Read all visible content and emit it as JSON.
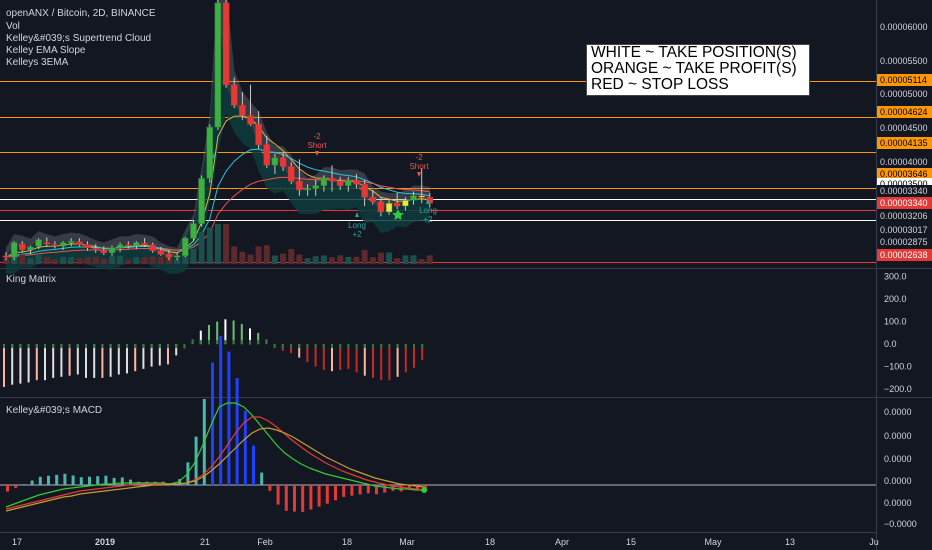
{
  "header": {
    "title": "openANX / Bitcoin, 2D, BINANCE",
    "studies": [
      "Vol",
      "Kelley&#039;s Supertrend Cloud",
      "Kelley EMA Slope",
      "Kelleys 3EMA"
    ]
  },
  "annotation": {
    "lines": [
      "WHITE ~ TAKE POSITION(S)",
      "ORANGE ~ TAKE PROFIT(S)",
      "RED ~ STOP LOSS"
    ]
  },
  "price_axis": {
    "ticks": [
      "0.00006000",
      "0.00005500",
      "0.00005000",
      "0.00004500",
      "0.00004000",
      "0.00003500",
      "0.00003017",
      "0.00002875"
    ],
    "badges": [
      {
        "text": "0.00005114",
        "kind": "orange"
      },
      {
        "text": "0.00004624",
        "kind": "orange"
      },
      {
        "text": "0.00004135",
        "kind": "orange"
      },
      {
        "text": "0.00003646",
        "kind": "orange"
      },
      {
        "text": "0.00003500",
        "kind": "white"
      },
      {
        "text": "0.00003340",
        "kind": "plain"
      },
      {
        "text": "0.00003340",
        "kind": "red"
      },
      {
        "text": "0.00003206",
        "kind": "plain"
      },
      {
        "text": "0.00002638",
        "kind": "red"
      }
    ]
  },
  "chart_markers": {
    "short1": [
      "-2",
      "Short"
    ],
    "short2": [
      "-2",
      "Short"
    ],
    "long1": [
      "Long",
      "+2"
    ],
    "long2": [
      "Long",
      "+2"
    ]
  },
  "king_matrix": {
    "title": "King Matrix",
    "ticks": [
      "300.0",
      "200.0",
      "100.0",
      "0.0",
      "−100.0",
      "−200.0"
    ]
  },
  "macd": {
    "title": "Kelley&#039;s MACD",
    "ticks": [
      "0.0000",
      "0.0000",
      "0.0000",
      "0.0000",
      "0.0000",
      "−0.0000",
      "−0.0000"
    ]
  },
  "time_axis": {
    "labels": [
      "17",
      "2019",
      "21",
      "Feb",
      "18",
      "Mar",
      "18",
      "Apr",
      "15",
      "May",
      "13",
      "Ju"
    ]
  },
  "colors": {
    "background": "#131722",
    "up": "#26a69a",
    "down": "#ef5350",
    "orange_level": "#ff9800",
    "red_level": "#e53935",
    "white_level": "#ffffff",
    "green_bar": "#7cb342",
    "blue_bar": "#1e40ff",
    "macd_green": "#33cc33",
    "macd_red": "#e53935",
    "macd_orange": "#c69c35"
  },
  "chart_data": [
    {
      "type": "candlestick",
      "title": "openANX / Bitcoin, 2D, BINANCE",
      "unit": "BTC",
      "ylim": [
        2.58e-05,
        6.22e-05
      ],
      "x_labels": [
        "17",
        "2019",
        "21",
        "Feb",
        "18",
        "Mar",
        "18",
        "Apr",
        "15",
        "May",
        "13",
        "Ju"
      ],
      "candles": [
        [
          2.72e-05,
          2.77e-05,
          2.66e-05,
          2.7e-05
        ],
        [
          2.7e-05,
          2.92e-05,
          2.66e-05,
          2.9e-05
        ],
        [
          2.88e-05,
          2.92e-05,
          2.76e-05,
          2.8e-05
        ],
        [
          2.8e-05,
          2.86e-05,
          2.74e-05,
          2.84e-05
        ],
        [
          2.85e-05,
          2.96e-05,
          2.81e-05,
          2.94e-05
        ],
        [
          2.9e-05,
          2.97e-05,
          2.84e-05,
          2.88e-05
        ],
        [
          2.87e-05,
          2.92e-05,
          2.82e-05,
          2.86e-05
        ],
        [
          2.85e-05,
          2.92e-05,
          2.8e-05,
          2.9e-05
        ],
        [
          2.9e-05,
          2.96e-05,
          2.85e-05,
          2.92e-05
        ],
        [
          2.91e-05,
          2.96e-05,
          2.85e-05,
          2.87e-05
        ],
        [
          2.87e-05,
          2.92e-05,
          2.79e-05,
          2.83e-05
        ],
        [
          2.82e-05,
          2.88e-05,
          2.76e-05,
          2.8e-05
        ],
        [
          2.79e-05,
          2.85e-05,
          2.73e-05,
          2.76e-05
        ],
        [
          2.76e-05,
          2.86e-05,
          2.72e-05,
          2.83e-05
        ],
        [
          2.82e-05,
          2.9e-05,
          2.77e-05,
          2.87e-05
        ],
        [
          2.87e-05,
          2.92e-05,
          2.82e-05,
          2.86e-05
        ],
        [
          2.86e-05,
          2.92e-05,
          2.81e-05,
          2.9e-05
        ],
        [
          2.89e-05,
          2.96e-05,
          2.84e-05,
          2.87e-05
        ],
        [
          2.87e-05,
          2.9e-05,
          2.76e-05,
          2.79e-05
        ],
        [
          2.79e-05,
          2.84e-05,
          2.72e-05,
          2.74e-05
        ],
        [
          2.74e-05,
          2.8e-05,
          2.66e-05,
          2.7e-05
        ],
        [
          2.7e-05,
          2.76e-05,
          2.66e-05,
          2.72e-05
        ],
        [
          2.72e-05,
          2.98e-05,
          2.7e-05,
          2.96e-05
        ],
        [
          2.96e-05,
          3.2e-05,
          2.92e-05,
          3.16e-05
        ],
        [
          3.16e-05,
          3.82e-05,
          3.12e-05,
          3.78e-05
        ],
        [
          3.78e-05,
          4.52e-05,
          3.72e-05,
          4.48e-05
        ],
        [
          4.48e-05,
          6.22e-05,
          4.44e-05,
          6.18e-05
        ],
        [
          6.18e-05,
          6.22e-05,
          5.02e-05,
          5.06e-05
        ],
        [
          5.06e-05,
          5.16e-05,
          4.74e-05,
          4.78e-05
        ],
        [
          4.78e-05,
          4.96e-05,
          4.58e-05,
          4.64e-05
        ],
        [
          4.64e-05,
          5.06e-05,
          4.5e-05,
          4.52e-05
        ],
        [
          4.52e-05,
          4.7e-05,
          4.18e-05,
          4.24e-05
        ],
        [
          4.24e-05,
          4.36e-05,
          3.92e-05,
          3.96e-05
        ],
        [
          3.96e-05,
          4.12e-05,
          3.84e-05,
          4.06e-05
        ],
        [
          4.06e-05,
          4.14e-05,
          3.88e-05,
          3.94e-05
        ],
        [
          3.94e-05,
          4e-05,
          3.7e-05,
          3.74e-05
        ],
        [
          3.74e-05,
          4.04e-05,
          3.54e-05,
          3.62e-05
        ],
        [
          3.62e-05,
          3.7e-05,
          3.54e-05,
          3.64e-05
        ],
        [
          3.64e-05,
          3.76e-05,
          3.54e-05,
          3.68e-05
        ],
        [
          3.68e-05,
          3.82e-05,
          3.6e-05,
          3.78e-05
        ],
        [
          3.78e-05,
          3.96e-05,
          3.6e-05,
          3.74e-05
        ],
        [
          3.74e-05,
          3.8e-05,
          3.62e-05,
          3.68e-05
        ],
        [
          3.68e-05,
          3.8e-05,
          3.6e-05,
          3.75e-05
        ],
        [
          3.75e-05,
          3.84e-05,
          3.64e-05,
          3.7e-05
        ],
        [
          3.7e-05,
          3.76e-05,
          3.4e-05,
          3.52e-05
        ],
        [
          3.52e-05,
          3.62e-05,
          3.42e-05,
          3.46e-05
        ],
        [
          3.46e-05,
          3.52e-05,
          3.26e-05,
          3.32e-05
        ],
        [
          3.32e-05,
          3.5e-05,
          3.28e-05,
          3.44e-05
        ],
        [
          3.44e-05,
          3.58e-05,
          3.36e-05,
          3.4e-05
        ],
        [
          3.4e-05,
          3.52e-05,
          3.34e-05,
          3.48e-05
        ],
        [
          3.48e-05,
          3.6e-05,
          3.42e-05,
          3.54e-05
        ],
        [
          3.54e-05,
          3.92e-05,
          3.44e-05,
          3.52e-05
        ],
        [
          3.52e-05,
          3.58e-05,
          3.38e-05,
          3.44e-05
        ]
      ],
      "levels": [
        5.114e-05,
        4.624e-05,
        4.135e-05,
        3.646e-05,
        3.5e-05,
        3.34e-05,
        3.206e-05,
        2.638e-05
      ]
    },
    {
      "type": "bar",
      "name": "King Matrix",
      "ylim": [
        -230,
        320
      ],
      "values": [
        -190,
        -180,
        -175,
        -170,
        -160,
        -160,
        -150,
        -145,
        -140,
        -135,
        -150,
        -150,
        -150,
        -145,
        -135,
        -130,
        -120,
        -110,
        -100,
        -95,
        -90,
        -50,
        -20,
        20,
        60,
        85,
        100,
        110,
        105,
        90,
        70,
        50,
        20,
        -10,
        -30,
        -40,
        -60,
        -80,
        -100,
        -115,
        -120,
        -115,
        -110,
        -125,
        -140,
        -150,
        -160,
        -160,
        -145,
        -125,
        -105,
        -70
      ],
      "ticks": [
        300,
        200,
        100,
        0,
        -100,
        -200
      ]
    },
    {
      "type": "line",
      "name": "Kelley&#039;s MACD",
      "ylim": [
        -4.5e-06,
        8.5e-06
      ],
      "series": [
        {
          "values": [
            -2.2e-06,
            -1.9e-06,
            -1.6e-06,
            -1.3e-06,
            -1e-06,
            -8e-07,
            -6e-07,
            -4e-07,
            -3e-07,
            -2e-07,
            -1e-07,
            0.0,
            1e-07,
            1e-07,
            2e-07,
            2e-07,
            2e-07,
            2e-07,
            2e-07,
            2e-07,
            1e-07,
            3e-07,
            1e-06,
            2.2e-06,
            4e-06,
            6e-06,
            7.8e-06,
            8.2e-06,
            8.2e-06,
            7.8e-06,
            7e-06,
            6e-06,
            5e-06,
            4e-06,
            3.2e-06,
            2.6e-06,
            2.1e-06,
            1.7e-06,
            1.4e-06,
            1.1e-06,
            9e-07,
            7e-07,
            5e-07,
            3e-07,
            1e-07,
            -1e-07,
            -2e-07,
            -3e-07,
            -4e-07,
            -4e-07,
            -5e-07,
            -5e-07
          ]
        },
        {
          "values": [
            -2.4e-06,
            -2.2e-06,
            -2e-06,
            -1.8e-06,
            -1.6e-06,
            -1.4e-06,
            -1.2e-06,
            -1e-06,
            -8e-07,
            -6e-07,
            -5e-07,
            -4e-07,
            -3e-07,
            -2e-07,
            -1e-07,
            0.0,
            1e-07,
            1e-07,
            1e-07,
            1e-07,
            1e-07,
            1e-07,
            2e-07,
            5e-07,
            1e-06,
            1.8e-06,
            2.8e-06,
            4e-06,
            5.2e-06,
            6.2e-06,
            6.8e-06,
            6.8e-06,
            6.4e-06,
            5.8e-06,
            5.1e-06,
            4.4e-06,
            3.8e-06,
            3.2e-06,
            2.7e-06,
            2.2e-06,
            1.8e-06,
            1.4e-06,
            1.1e-06,
            8e-07,
            5e-07,
            3e-07,
            1e-07,
            -1e-07,
            -2e-07,
            -3e-07,
            -4e-07,
            -5e-07
          ]
        },
        {
          "values": [
            -2.6e-06,
            -2.4e-06,
            -2.2e-06,
            -2e-06,
            -1.8e-06,
            -1.6e-06,
            -1.4e-06,
            -1.2e-06,
            -1.1e-06,
            -9e-07,
            -8e-07,
            -7e-07,
            -6e-07,
            -5e-07,
            -4e-07,
            -3e-07,
            -2e-07,
            -1e-07,
            0.0,
            0.0,
            1e-07,
            1e-07,
            2e-07,
            4e-07,
            8e-07,
            1.4e-06,
            2.1e-06,
            2.9e-06,
            3.7e-06,
            4.5e-06,
            5.2e-06,
            5.6e-06,
            5.7e-06,
            5.5e-06,
            5.2e-06,
            4.8e-06,
            4.3e-06,
            3.8e-06,
            3.3e-06,
            2.8e-06,
            2.4e-06,
            2e-06,
            1.6e-06,
            1.3e-06,
            1e-06,
            7e-07,
            5e-07,
            3e-07,
            1e-07,
            0.0,
            -1e-07,
            -2e-07
          ]
        }
      ],
      "ticks": [
        0.0,
        0.0,
        0.0,
        0.0,
        0.0,
        -0.0,
        -0.0
      ]
    }
  ]
}
